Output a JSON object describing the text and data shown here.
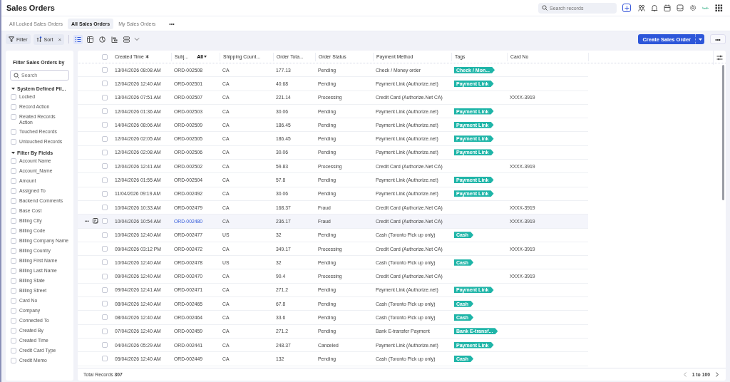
{
  "header": {
    "title": "Sales Orders",
    "search": {
      "placeholder": "Search records"
    }
  },
  "views": [
    {
      "label": "All Locked Sales Orders",
      "selected": false
    },
    {
      "label": "All Sales Orders",
      "selected": true
    },
    {
      "label": "My Sales Orders",
      "selected": false
    }
  ],
  "views_more": "•••",
  "toolbar": {
    "filter": "Filter",
    "sort": "Sort",
    "sort_clear": "×",
    "view_modes": [
      {
        "kind": "list",
        "selected": true
      },
      {
        "kind": "table",
        "selected": false
      },
      {
        "kind": "chart",
        "selected": false
      },
      {
        "kind": "timeline",
        "selected": false
      },
      {
        "kind": "kanban",
        "selected": false
      }
    ],
    "create": "Create Sales Order",
    "more": "•••"
  },
  "sidebar": {
    "title": "Filter Sales Orders by",
    "search": {
      "placeholder": "Search"
    },
    "sections": [
      {
        "title": "System Defined Fil...",
        "expanded": true,
        "items": [
          {
            "label": "Locked",
            "checked": false
          },
          {
            "label": "Record Action",
            "checked": false
          },
          {
            "label": "Related Records Action",
            "checked": false
          },
          {
            "label": "Touched Records",
            "checked": false
          },
          {
            "label": "Untouched Records",
            "checked": false
          }
        ]
      },
      {
        "title": "Filter By Fields",
        "expanded": true,
        "items": [
          {
            "label": "Account Name",
            "checked": false
          },
          {
            "label": "Account_Name",
            "checked": false
          },
          {
            "label": "Amount",
            "checked": false
          },
          {
            "label": "Assigned To",
            "checked": false
          },
          {
            "label": "Backend Comments",
            "checked": false
          },
          {
            "label": "Base Cost",
            "checked": false
          },
          {
            "label": "Billing City",
            "checked": false
          },
          {
            "label": "Billing Code",
            "checked": false
          },
          {
            "label": "Billing Company Name",
            "checked": false
          },
          {
            "label": "Billing Country",
            "checked": false
          },
          {
            "label": "Billing First Name",
            "checked": false
          },
          {
            "label": "Billing Last Name",
            "checked": false
          },
          {
            "label": "Billing State",
            "checked": false
          },
          {
            "label": "Billing Street",
            "checked": false
          },
          {
            "label": "Card No",
            "checked": false
          },
          {
            "label": "Company",
            "checked": false
          },
          {
            "label": "Connected To",
            "checked": false
          },
          {
            "label": "Created By",
            "checked": false
          },
          {
            "label": "Created Time",
            "checked": false
          },
          {
            "label": "Credit Card Type",
            "checked": false
          },
          {
            "label": "Credit Memo",
            "checked": false
          }
        ]
      }
    ]
  },
  "table": {
    "columns": [
      {
        "label": "Created Time",
        "sorted": true
      },
      {
        "label": "Subj...",
        "filter": "All"
      },
      {
        "label": "Shipping Count..."
      },
      {
        "label": "Order Tota..."
      },
      {
        "label": "Order Status"
      },
      {
        "label": "Payment Method"
      },
      {
        "label": "Tags"
      },
      {
        "label": "Card No"
      }
    ],
    "select_all": {
      "checked": false
    },
    "row_actions": "•••",
    "rows": [
      {
        "created": "13/04/2026 08:08 AM",
        "subject": "ORD-002508",
        "country": "CA",
        "total": "177.13",
        "status": "Pending",
        "payment": "Check / Money order",
        "tag": "Check / Mon...",
        "checked": false,
        "hovered": false
      },
      {
        "created": "12/04/2026 12:40 AM",
        "subject": "ORD-002501",
        "country": "CA",
        "total": "40.68",
        "status": "Pending",
        "payment": "Payment Link (Authorize.net)",
        "tag": "Payment Link",
        "checked": false,
        "hovered": false
      },
      {
        "created": "13/04/2026 07:51 AM",
        "subject": "ORD-002507",
        "country": "CA",
        "total": "221.14",
        "status": "Processing",
        "payment": "Credit Card (Authorize.Net CA)",
        "card": "XXXX-3919",
        "checked": false,
        "hovered": false
      },
      {
        "created": "12/04/2026 01:36 AM",
        "subject": "ORD-002503",
        "country": "CA",
        "total": "30.06",
        "status": "Pending",
        "payment": "Payment Link (Authorize.net)",
        "tag": "Payment Link",
        "checked": false,
        "hovered": false
      },
      {
        "created": "14/04/2026 08:06 AM",
        "subject": "ORD-002509",
        "country": "CA",
        "total": "186.45",
        "status": "Pending",
        "payment": "Payment Link (Authorize.net)",
        "tag": "Payment Link",
        "checked": false,
        "hovered": false
      },
      {
        "created": "12/04/2026 02:05 AM",
        "subject": "ORD-002505",
        "country": "CA",
        "total": "186.45",
        "status": "Pending",
        "payment": "Payment Link (Authorize.net)",
        "tag": "Payment Link",
        "checked": false,
        "hovered": false
      },
      {
        "created": "12/04/2026 02:08 AM",
        "subject": "ORD-002506",
        "country": "CA",
        "total": "30.06",
        "status": "Pending",
        "payment": "Payment Link (Authorize.net)",
        "tag": "Payment Link",
        "checked": false,
        "hovered": false
      },
      {
        "created": "12/04/2026 12:41 AM",
        "subject": "ORD-002502",
        "country": "CA",
        "total": "59.83",
        "status": "Processing",
        "payment": "Credit Card (Authorize.Net CA)",
        "card": "XXXX-3919",
        "checked": false,
        "hovered": false
      },
      {
        "created": "12/04/2026 01:55 AM",
        "subject": "ORD-002504",
        "country": "CA",
        "total": "57.8",
        "status": "Pending",
        "payment": "Payment Link (Authorize.net)",
        "tag": "Payment Link",
        "checked": false,
        "hovered": false
      },
      {
        "created": "11/04/2026 09:19 AM",
        "subject": "ORD-002492",
        "country": "CA",
        "total": "30.06",
        "status": "Pending",
        "payment": "Payment Link (Authorize.net)",
        "tag": "Payment Link",
        "checked": false,
        "hovered": false
      },
      {
        "created": "10/04/2026 10:33 AM",
        "subject": "ORD-002479",
        "country": "CA",
        "total": "168.37",
        "status": "Fraud",
        "payment": "Credit Card (Authorize.Net CA)",
        "card": "XXXX-3919",
        "checked": false,
        "hovered": false
      },
      {
        "created": "10/04/2026 10:54 AM",
        "subject": "ORD-002480",
        "country": "CA",
        "total": "236.17",
        "status": "Fraud",
        "payment": "Credit Card (Authorize.Net CA)",
        "card": "XXXX-3919",
        "checked": false,
        "hovered": true
      },
      {
        "created": "10/04/2026 12:40 AM",
        "subject": "ORD-002477",
        "country": "US",
        "total": "32",
        "status": "Pending",
        "payment": "Cash (Toronto Pick up only)",
        "tag": "Cash",
        "checked": false,
        "hovered": false
      },
      {
        "created": "09/04/2026 03:12 PM",
        "subject": "ORD-002472",
        "country": "CA",
        "total": "349.17",
        "status": "Processing",
        "payment": "Credit Card (Authorize.Net CA)",
        "card": "XXXX-3919",
        "checked": false,
        "hovered": false
      },
      {
        "created": "10/04/2026 12:40 AM",
        "subject": "ORD-002478",
        "country": "US",
        "total": "32",
        "status": "Pending",
        "payment": "Cash (Toronto Pick up only)",
        "tag": "Cash",
        "checked": false,
        "hovered": false
      },
      {
        "created": "09/04/2026 12:40 AM",
        "subject": "ORD-002470",
        "country": "CA",
        "total": "90.4",
        "status": "Processing",
        "payment": "Credit Card (Authorize.Net CA)",
        "card": "XXXX-3919",
        "checked": false,
        "hovered": false
      },
      {
        "created": "09/04/2026 12:41 AM",
        "subject": "ORD-002471",
        "country": "CA",
        "total": "271.2",
        "status": "Pending",
        "payment": "Payment Link (Authorize.net)",
        "tag": "Payment Link",
        "checked": false,
        "hovered": false
      },
      {
        "created": "08/04/2026 12:40 AM",
        "subject": "ORD-002465",
        "country": "CA",
        "total": "67.8",
        "status": "Pending",
        "payment": "Cash (Toronto Pick up only)",
        "tag": "Cash",
        "checked": false,
        "hovered": false
      },
      {
        "created": "08/04/2026 12:40 AM",
        "subject": "ORD-002464",
        "country": "CA",
        "total": "33.6",
        "status": "Pending",
        "payment": "Cash (Toronto Pick up only)",
        "tag": "Cash",
        "checked": false,
        "hovered": false
      },
      {
        "created": "07/04/2026 12:40 AM",
        "subject": "ORD-002459",
        "country": "CA",
        "total": "271.2",
        "status": "Pending",
        "payment": "Bank E-transfer Payment",
        "tag": "Bank E-transf...",
        "checked": false,
        "hovered": false
      },
      {
        "created": "04/04/2026 05:29 AM",
        "subject": "ORD-002441",
        "country": "CA",
        "total": "248.37",
        "status": "Canceled",
        "payment": "Payment Link (Authorize.net)",
        "tag": "Payment Link",
        "checked": false,
        "hovered": false
      },
      {
        "created": "05/04/2026 12:40 AM",
        "subject": "ORD-002449",
        "country": "CA",
        "total": "132",
        "status": "Pending",
        "payment": "Cash (Toronto Pick up only)",
        "tag": "Cash",
        "checked": false,
        "hovered": false
      }
    ],
    "total": "Total Records **307**",
    "pagination": "1 to 100"
  }
}
